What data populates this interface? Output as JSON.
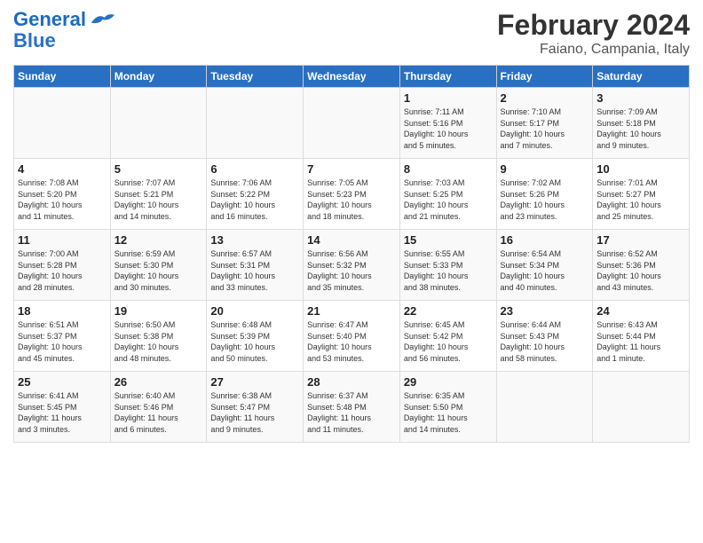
{
  "header": {
    "logo_line1": "General",
    "logo_line2": "Blue",
    "title": "February 2024",
    "subtitle": "Faiano, Campania, Italy"
  },
  "days_of_week": [
    "Sunday",
    "Monday",
    "Tuesday",
    "Wednesday",
    "Thursday",
    "Friday",
    "Saturday"
  ],
  "weeks": [
    [
      {
        "num": "",
        "info": ""
      },
      {
        "num": "",
        "info": ""
      },
      {
        "num": "",
        "info": ""
      },
      {
        "num": "",
        "info": ""
      },
      {
        "num": "1",
        "info": "Sunrise: 7:11 AM\nSunset: 5:16 PM\nDaylight: 10 hours\nand 5 minutes."
      },
      {
        "num": "2",
        "info": "Sunrise: 7:10 AM\nSunset: 5:17 PM\nDaylight: 10 hours\nand 7 minutes."
      },
      {
        "num": "3",
        "info": "Sunrise: 7:09 AM\nSunset: 5:18 PM\nDaylight: 10 hours\nand 9 minutes."
      }
    ],
    [
      {
        "num": "4",
        "info": "Sunrise: 7:08 AM\nSunset: 5:20 PM\nDaylight: 10 hours\nand 11 minutes."
      },
      {
        "num": "5",
        "info": "Sunrise: 7:07 AM\nSunset: 5:21 PM\nDaylight: 10 hours\nand 14 minutes."
      },
      {
        "num": "6",
        "info": "Sunrise: 7:06 AM\nSunset: 5:22 PM\nDaylight: 10 hours\nand 16 minutes."
      },
      {
        "num": "7",
        "info": "Sunrise: 7:05 AM\nSunset: 5:23 PM\nDaylight: 10 hours\nand 18 minutes."
      },
      {
        "num": "8",
        "info": "Sunrise: 7:03 AM\nSunset: 5:25 PM\nDaylight: 10 hours\nand 21 minutes."
      },
      {
        "num": "9",
        "info": "Sunrise: 7:02 AM\nSunset: 5:26 PM\nDaylight: 10 hours\nand 23 minutes."
      },
      {
        "num": "10",
        "info": "Sunrise: 7:01 AM\nSunset: 5:27 PM\nDaylight: 10 hours\nand 25 minutes."
      }
    ],
    [
      {
        "num": "11",
        "info": "Sunrise: 7:00 AM\nSunset: 5:28 PM\nDaylight: 10 hours\nand 28 minutes."
      },
      {
        "num": "12",
        "info": "Sunrise: 6:59 AM\nSunset: 5:30 PM\nDaylight: 10 hours\nand 30 minutes."
      },
      {
        "num": "13",
        "info": "Sunrise: 6:57 AM\nSunset: 5:31 PM\nDaylight: 10 hours\nand 33 minutes."
      },
      {
        "num": "14",
        "info": "Sunrise: 6:56 AM\nSunset: 5:32 PM\nDaylight: 10 hours\nand 35 minutes."
      },
      {
        "num": "15",
        "info": "Sunrise: 6:55 AM\nSunset: 5:33 PM\nDaylight: 10 hours\nand 38 minutes."
      },
      {
        "num": "16",
        "info": "Sunrise: 6:54 AM\nSunset: 5:34 PM\nDaylight: 10 hours\nand 40 minutes."
      },
      {
        "num": "17",
        "info": "Sunrise: 6:52 AM\nSunset: 5:36 PM\nDaylight: 10 hours\nand 43 minutes."
      }
    ],
    [
      {
        "num": "18",
        "info": "Sunrise: 6:51 AM\nSunset: 5:37 PM\nDaylight: 10 hours\nand 45 minutes."
      },
      {
        "num": "19",
        "info": "Sunrise: 6:50 AM\nSunset: 5:38 PM\nDaylight: 10 hours\nand 48 minutes."
      },
      {
        "num": "20",
        "info": "Sunrise: 6:48 AM\nSunset: 5:39 PM\nDaylight: 10 hours\nand 50 minutes."
      },
      {
        "num": "21",
        "info": "Sunrise: 6:47 AM\nSunset: 5:40 PM\nDaylight: 10 hours\nand 53 minutes."
      },
      {
        "num": "22",
        "info": "Sunrise: 6:45 AM\nSunset: 5:42 PM\nDaylight: 10 hours\nand 56 minutes."
      },
      {
        "num": "23",
        "info": "Sunrise: 6:44 AM\nSunset: 5:43 PM\nDaylight: 10 hours\nand 58 minutes."
      },
      {
        "num": "24",
        "info": "Sunrise: 6:43 AM\nSunset: 5:44 PM\nDaylight: 11 hours\nand 1 minute."
      }
    ],
    [
      {
        "num": "25",
        "info": "Sunrise: 6:41 AM\nSunset: 5:45 PM\nDaylight: 11 hours\nand 3 minutes."
      },
      {
        "num": "26",
        "info": "Sunrise: 6:40 AM\nSunset: 5:46 PM\nDaylight: 11 hours\nand 6 minutes."
      },
      {
        "num": "27",
        "info": "Sunrise: 6:38 AM\nSunset: 5:47 PM\nDaylight: 11 hours\nand 9 minutes."
      },
      {
        "num": "28",
        "info": "Sunrise: 6:37 AM\nSunset: 5:48 PM\nDaylight: 11 hours\nand 11 minutes."
      },
      {
        "num": "29",
        "info": "Sunrise: 6:35 AM\nSunset: 5:50 PM\nDaylight: 11 hours\nand 14 minutes."
      },
      {
        "num": "",
        "info": ""
      },
      {
        "num": "",
        "info": ""
      }
    ]
  ]
}
